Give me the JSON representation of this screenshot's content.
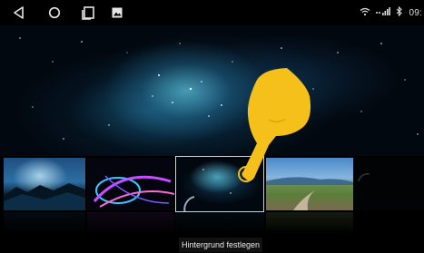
{
  "statusbar": {
    "nav_icons": [
      "back-icon",
      "home-icon",
      "recents-icon",
      "gallery-icon"
    ],
    "status_icons": [
      "wifi-icon",
      "signal-icon",
      "bluetooth-icon"
    ],
    "clock": "09:"
  },
  "wallpapers": [
    {
      "name": "blue-ice-landscape"
    },
    {
      "name": "purple-light-swirl"
    },
    {
      "name": "teal-nebula-space",
      "selected": true
    },
    {
      "name": "green-valley-road"
    },
    {
      "name": "dark-night-sky"
    }
  ],
  "action": {
    "set_wallpaper_label": "Hintergrund festlegen"
  },
  "colors": {
    "hand": "#f5c01a",
    "selection_border": "#cfcfcf",
    "background": "#000000"
  }
}
